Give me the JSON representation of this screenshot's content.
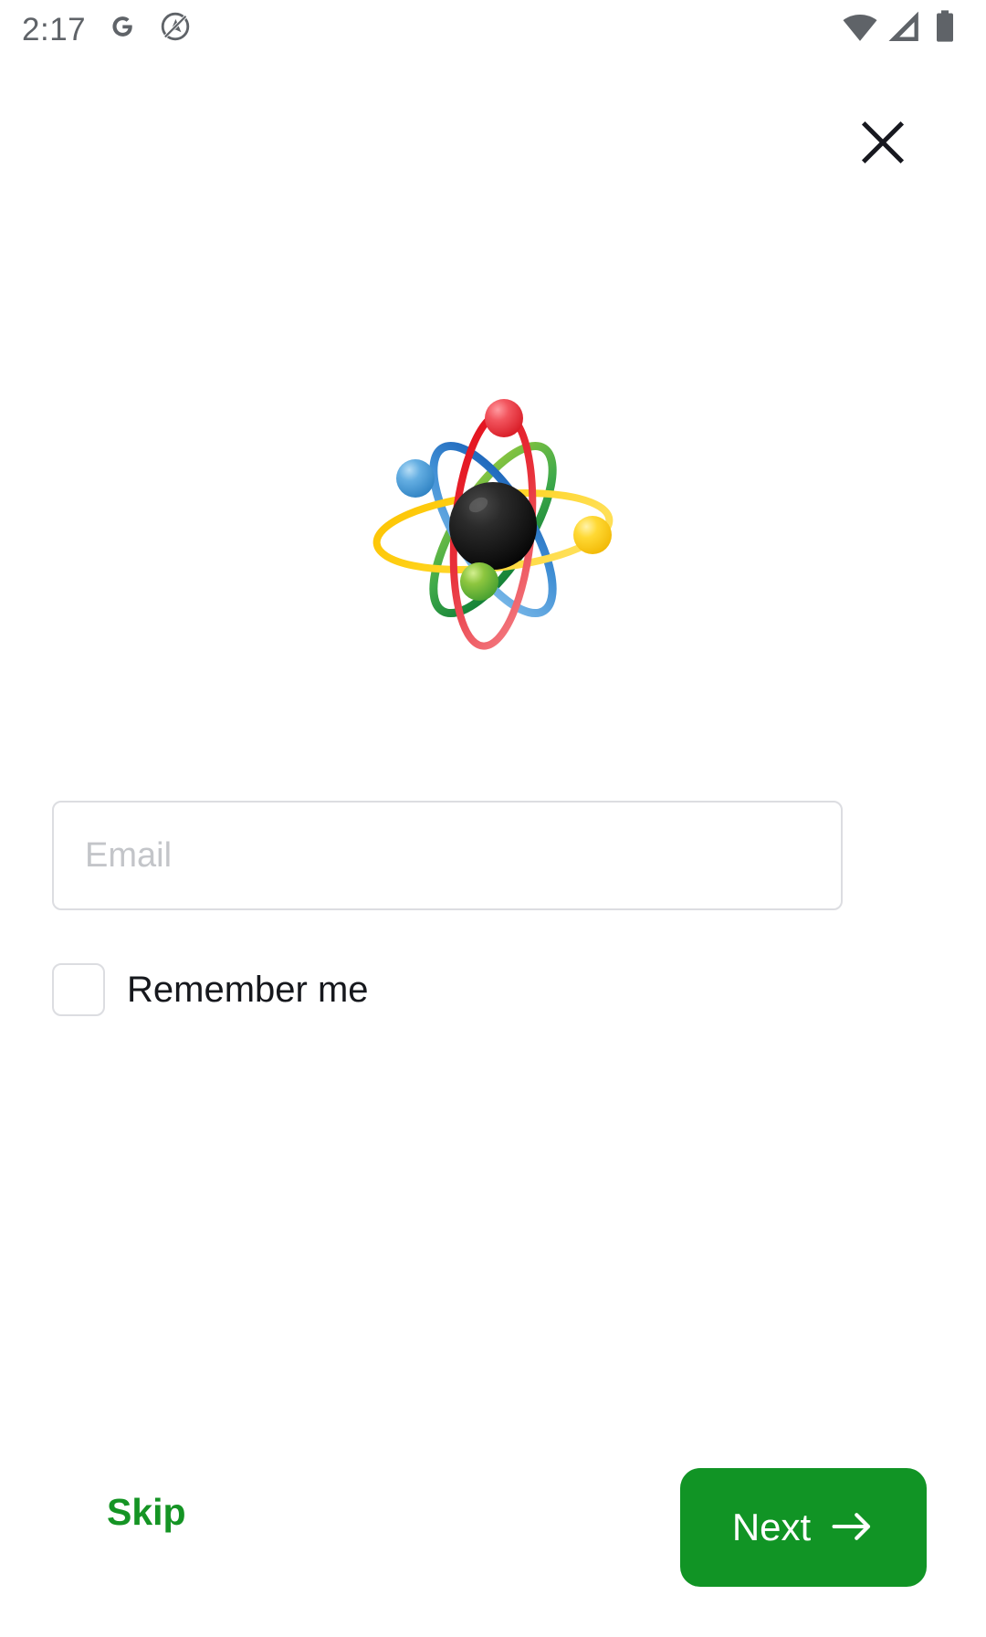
{
  "status_bar": {
    "clock": "2:17",
    "left_icons": [
      {
        "name": "google-g-icon",
        "glyph": "G"
      },
      {
        "name": "no-navigation-icon",
        "glyph": "circle-slash-arrow"
      }
    ],
    "right_icons": [
      {
        "name": "wifi-icon",
        "glyph": "wifi"
      },
      {
        "name": "cellular-signal-icon",
        "glyph": "signal-triangle"
      },
      {
        "name": "battery-icon",
        "glyph": "battery-full"
      }
    ],
    "icon_color": "#5f6368"
  },
  "header": {
    "close_icon": "close-icon",
    "close_color": "#17181f"
  },
  "logo": {
    "name": "atom-logo",
    "nucleus_color": "#141414",
    "orbits": [
      {
        "name": "yellow-orbit",
        "color": "#ffd21a"
      },
      {
        "name": "red-orbit",
        "color": "#e8202a"
      },
      {
        "name": "blue-orbit",
        "color": "#1f6fc4"
      },
      {
        "name": "green-orbit",
        "color": "#7cc142"
      }
    ],
    "electrons": [
      {
        "name": "red-electron",
        "color": "#ee3b42"
      },
      {
        "name": "blue-electron",
        "color": "#5aa9e0"
      },
      {
        "name": "yellow-electron",
        "color": "#ffd21a"
      },
      {
        "name": "green-electron",
        "color": "#7cc142"
      }
    ]
  },
  "form": {
    "email": {
      "placeholder": "Email",
      "value": ""
    },
    "remember": {
      "label": "Remember me",
      "checked": false
    }
  },
  "footer": {
    "skip_label": "Skip",
    "next_label": "Next",
    "next_arrow_icon": "arrow-right-icon",
    "accent_color": "#119425"
  }
}
